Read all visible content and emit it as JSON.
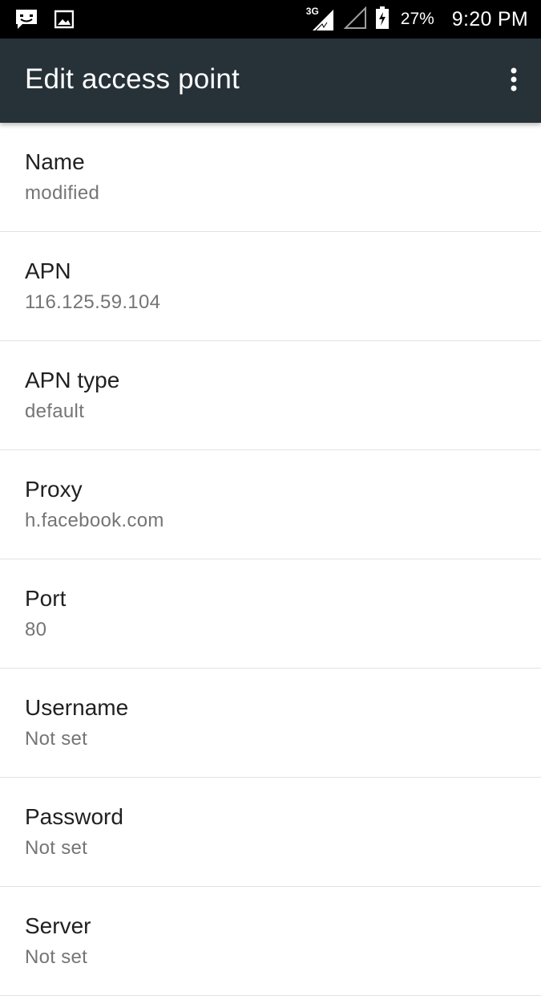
{
  "status_bar": {
    "left_icons": [
      "message-icon",
      "image-icon"
    ],
    "network_label": "3G",
    "battery_percent": "27%",
    "time": "9:20 PM"
  },
  "app_bar": {
    "title": "Edit access point",
    "overflow_icon": "more-vert-icon"
  },
  "fields": [
    {
      "title": "Name",
      "summary": "modified"
    },
    {
      "title": "APN",
      "summary": "116.125.59.104"
    },
    {
      "title": "APN type",
      "summary": "default"
    },
    {
      "title": "Proxy",
      "summary": "h.facebook.com"
    },
    {
      "title": "Port",
      "summary": "80"
    },
    {
      "title": "Username",
      "summary": "Not set"
    },
    {
      "title": "Password",
      "summary": "Not set"
    },
    {
      "title": "Server",
      "summary": "Not set"
    }
  ]
}
